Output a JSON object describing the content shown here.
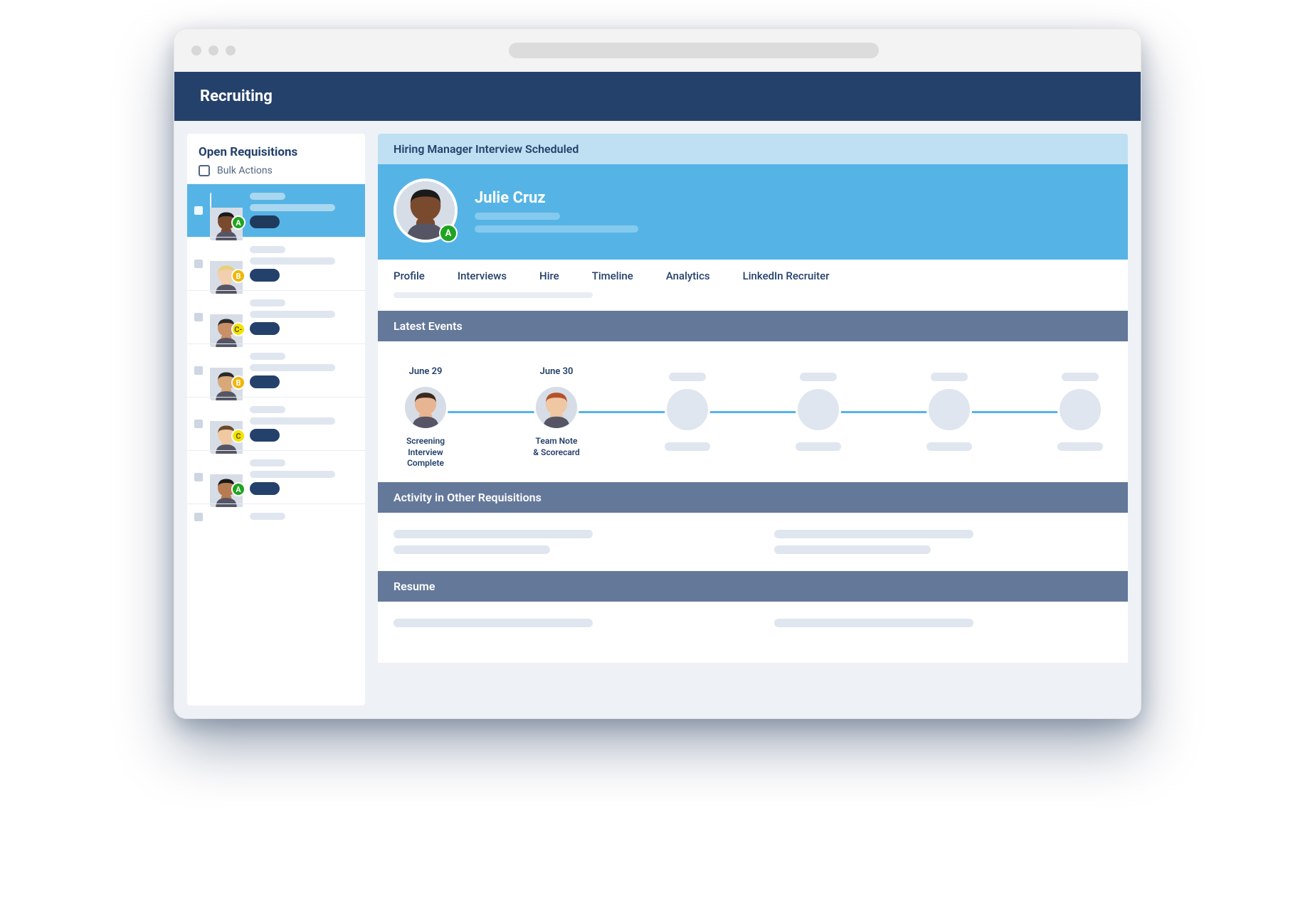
{
  "app": {
    "title": "Recruiting"
  },
  "sidebar": {
    "title": "Open Requisitions",
    "bulk_label": "Bulk Actions",
    "candidates": [
      {
        "badge": "A",
        "selected": true,
        "skin": "#7a4a2e",
        "hair": "#1a1a1a"
      },
      {
        "badge": "B",
        "selected": false,
        "skin": "#f1cfaf",
        "hair": "#e7d07a"
      },
      {
        "badge": "C-",
        "selected": false,
        "skin": "#c98f67",
        "hair": "#2a2a2a"
      },
      {
        "badge": "B",
        "selected": false,
        "skin": "#d9a878",
        "hair": "#2a2a2a"
      },
      {
        "badge": "C",
        "selected": false,
        "skin": "#f0c9a3",
        "hair": "#6a4a2a"
      },
      {
        "badge": "A",
        "selected": false,
        "skin": "#b77b52",
        "hair": "#1a1a1a"
      }
    ]
  },
  "status_banner": "Hiring Manager Interview Scheduled",
  "candidate": {
    "name": "Julie Cruz",
    "badge": "A",
    "skin": "#7a4a2e",
    "hair": "#1a1a1a"
  },
  "tabs": [
    "Profile",
    "Interviews",
    "Hire",
    "Timeline",
    "Analytics",
    "LinkedIn Recruiter"
  ],
  "sections": {
    "latest_events": "Latest Events",
    "activity": "Activity in Other Requisitions",
    "resume": "Resume"
  },
  "timeline": [
    {
      "date": "June 29",
      "label_l1": "Screening",
      "label_l2": "Interview Complete",
      "has_avatar": true,
      "skin": "#e7b591",
      "hair": "#3a2a20"
    },
    {
      "date": "June 30",
      "label_l1": "Team Note",
      "label_l2": "& Scorecard",
      "has_avatar": true,
      "skin": "#f0c7a3",
      "hair": "#b5512a"
    },
    {
      "date": "",
      "label_l1": "",
      "label_l2": "",
      "has_avatar": false
    },
    {
      "date": "",
      "label_l1": "",
      "label_l2": "",
      "has_avatar": false
    },
    {
      "date": "",
      "label_l1": "",
      "label_l2": "",
      "has_avatar": false
    },
    {
      "date": "",
      "label_l1": "",
      "label_l2": "",
      "has_avatar": false
    }
  ]
}
